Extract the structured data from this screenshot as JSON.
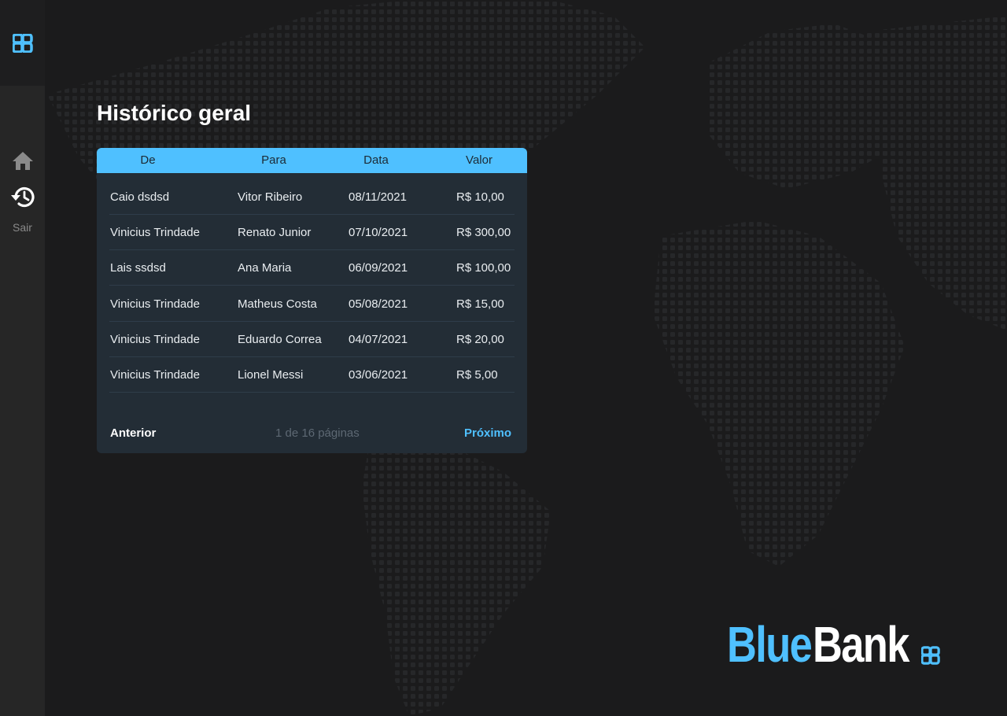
{
  "colors": {
    "accent": "#4fc0ff",
    "background": "#1b1b1c",
    "sidebar": "#262626",
    "card": "#232d36",
    "text": "#e9edf0"
  },
  "sidebar": {
    "logo_icon": "bluebank-logo-icon",
    "items": [
      {
        "icon": "home-icon"
      },
      {
        "icon": "history-icon"
      }
    ],
    "exit_label": "Sair"
  },
  "page": {
    "title": "Histórico geral"
  },
  "table": {
    "columns": [
      "De",
      "Para",
      "Data",
      "Valor"
    ],
    "rows": [
      {
        "from": "Caio dsdsd",
        "to": "Vitor Ribeiro",
        "date": "08/11/2021",
        "value": "R$ 10,00"
      },
      {
        "from": "Vinicius Trindade",
        "to": "Renato Junior",
        "date": "07/10/2021",
        "value": "R$ 300,00"
      },
      {
        "from": "Lais ssdsd",
        "to": "Ana Maria",
        "date": "06/09/2021",
        "value": "R$ 100,00"
      },
      {
        "from": "Vinicius Trindade",
        "to": "Matheus Costa",
        "date": "05/08/2021",
        "value": "R$ 15,00"
      },
      {
        "from": "Vinicius Trindade",
        "to": "Eduardo Correa",
        "date": "04/07/2021",
        "value": "R$ 20,00"
      },
      {
        "from": "Vinicius Trindade",
        "to": "Lionel Messi",
        "date": "03/06/2021",
        "value": "R$ 5,00"
      }
    ]
  },
  "pagination": {
    "prev_label": "Anterior",
    "info": "1 de 16 páginas",
    "next_label": "Próximo"
  },
  "brand": {
    "name_part1": "Blue",
    "name_part2": "Bank"
  }
}
